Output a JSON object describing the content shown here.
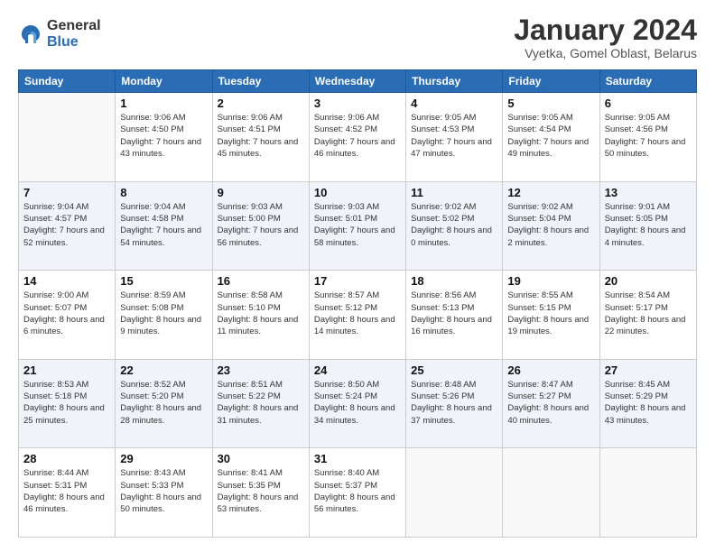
{
  "logo": {
    "general": "General",
    "blue": "Blue"
  },
  "title": "January 2024",
  "location": "Vyetka, Gomel Oblast, Belarus",
  "days_header": [
    "Sunday",
    "Monday",
    "Tuesday",
    "Wednesday",
    "Thursday",
    "Friday",
    "Saturday"
  ],
  "weeks": [
    [
      {
        "day": "",
        "sunrise": "",
        "sunset": "",
        "daylight": ""
      },
      {
        "day": "1",
        "sunrise": "Sunrise: 9:06 AM",
        "sunset": "Sunset: 4:50 PM",
        "daylight": "Daylight: 7 hours and 43 minutes."
      },
      {
        "day": "2",
        "sunrise": "Sunrise: 9:06 AM",
        "sunset": "Sunset: 4:51 PM",
        "daylight": "Daylight: 7 hours and 45 minutes."
      },
      {
        "day": "3",
        "sunrise": "Sunrise: 9:06 AM",
        "sunset": "Sunset: 4:52 PM",
        "daylight": "Daylight: 7 hours and 46 minutes."
      },
      {
        "day": "4",
        "sunrise": "Sunrise: 9:05 AM",
        "sunset": "Sunset: 4:53 PM",
        "daylight": "Daylight: 7 hours and 47 minutes."
      },
      {
        "day": "5",
        "sunrise": "Sunrise: 9:05 AM",
        "sunset": "Sunset: 4:54 PM",
        "daylight": "Daylight: 7 hours and 49 minutes."
      },
      {
        "day": "6",
        "sunrise": "Sunrise: 9:05 AM",
        "sunset": "Sunset: 4:56 PM",
        "daylight": "Daylight: 7 hours and 50 minutes."
      }
    ],
    [
      {
        "day": "7",
        "sunrise": "Sunrise: 9:04 AM",
        "sunset": "Sunset: 4:57 PM",
        "daylight": "Daylight: 7 hours and 52 minutes."
      },
      {
        "day": "8",
        "sunrise": "Sunrise: 9:04 AM",
        "sunset": "Sunset: 4:58 PM",
        "daylight": "Daylight: 7 hours and 54 minutes."
      },
      {
        "day": "9",
        "sunrise": "Sunrise: 9:03 AM",
        "sunset": "Sunset: 5:00 PM",
        "daylight": "Daylight: 7 hours and 56 minutes."
      },
      {
        "day": "10",
        "sunrise": "Sunrise: 9:03 AM",
        "sunset": "Sunset: 5:01 PM",
        "daylight": "Daylight: 7 hours and 58 minutes."
      },
      {
        "day": "11",
        "sunrise": "Sunrise: 9:02 AM",
        "sunset": "Sunset: 5:02 PM",
        "daylight": "Daylight: 8 hours and 0 minutes."
      },
      {
        "day": "12",
        "sunrise": "Sunrise: 9:02 AM",
        "sunset": "Sunset: 5:04 PM",
        "daylight": "Daylight: 8 hours and 2 minutes."
      },
      {
        "day": "13",
        "sunrise": "Sunrise: 9:01 AM",
        "sunset": "Sunset: 5:05 PM",
        "daylight": "Daylight: 8 hours and 4 minutes."
      }
    ],
    [
      {
        "day": "14",
        "sunrise": "Sunrise: 9:00 AM",
        "sunset": "Sunset: 5:07 PM",
        "daylight": "Daylight: 8 hours and 6 minutes."
      },
      {
        "day": "15",
        "sunrise": "Sunrise: 8:59 AM",
        "sunset": "Sunset: 5:08 PM",
        "daylight": "Daylight: 8 hours and 9 minutes."
      },
      {
        "day": "16",
        "sunrise": "Sunrise: 8:58 AM",
        "sunset": "Sunset: 5:10 PM",
        "daylight": "Daylight: 8 hours and 11 minutes."
      },
      {
        "day": "17",
        "sunrise": "Sunrise: 8:57 AM",
        "sunset": "Sunset: 5:12 PM",
        "daylight": "Daylight: 8 hours and 14 minutes."
      },
      {
        "day": "18",
        "sunrise": "Sunrise: 8:56 AM",
        "sunset": "Sunset: 5:13 PM",
        "daylight": "Daylight: 8 hours and 16 minutes."
      },
      {
        "day": "19",
        "sunrise": "Sunrise: 8:55 AM",
        "sunset": "Sunset: 5:15 PM",
        "daylight": "Daylight: 8 hours and 19 minutes."
      },
      {
        "day": "20",
        "sunrise": "Sunrise: 8:54 AM",
        "sunset": "Sunset: 5:17 PM",
        "daylight": "Daylight: 8 hours and 22 minutes."
      }
    ],
    [
      {
        "day": "21",
        "sunrise": "Sunrise: 8:53 AM",
        "sunset": "Sunset: 5:18 PM",
        "daylight": "Daylight: 8 hours and 25 minutes."
      },
      {
        "day": "22",
        "sunrise": "Sunrise: 8:52 AM",
        "sunset": "Sunset: 5:20 PM",
        "daylight": "Daylight: 8 hours and 28 minutes."
      },
      {
        "day": "23",
        "sunrise": "Sunrise: 8:51 AM",
        "sunset": "Sunset: 5:22 PM",
        "daylight": "Daylight: 8 hours and 31 minutes."
      },
      {
        "day": "24",
        "sunrise": "Sunrise: 8:50 AM",
        "sunset": "Sunset: 5:24 PM",
        "daylight": "Daylight: 8 hours and 34 minutes."
      },
      {
        "day": "25",
        "sunrise": "Sunrise: 8:48 AM",
        "sunset": "Sunset: 5:26 PM",
        "daylight": "Daylight: 8 hours and 37 minutes."
      },
      {
        "day": "26",
        "sunrise": "Sunrise: 8:47 AM",
        "sunset": "Sunset: 5:27 PM",
        "daylight": "Daylight: 8 hours and 40 minutes."
      },
      {
        "day": "27",
        "sunrise": "Sunrise: 8:45 AM",
        "sunset": "Sunset: 5:29 PM",
        "daylight": "Daylight: 8 hours and 43 minutes."
      }
    ],
    [
      {
        "day": "28",
        "sunrise": "Sunrise: 8:44 AM",
        "sunset": "Sunset: 5:31 PM",
        "daylight": "Daylight: 8 hours and 46 minutes."
      },
      {
        "day": "29",
        "sunrise": "Sunrise: 8:43 AM",
        "sunset": "Sunset: 5:33 PM",
        "daylight": "Daylight: 8 hours and 50 minutes."
      },
      {
        "day": "30",
        "sunrise": "Sunrise: 8:41 AM",
        "sunset": "Sunset: 5:35 PM",
        "daylight": "Daylight: 8 hours and 53 minutes."
      },
      {
        "day": "31",
        "sunrise": "Sunrise: 8:40 AM",
        "sunset": "Sunset: 5:37 PM",
        "daylight": "Daylight: 8 hours and 56 minutes."
      },
      {
        "day": "",
        "sunrise": "",
        "sunset": "",
        "daylight": ""
      },
      {
        "day": "",
        "sunrise": "",
        "sunset": "",
        "daylight": ""
      },
      {
        "day": "",
        "sunrise": "",
        "sunset": "",
        "daylight": ""
      }
    ]
  ]
}
